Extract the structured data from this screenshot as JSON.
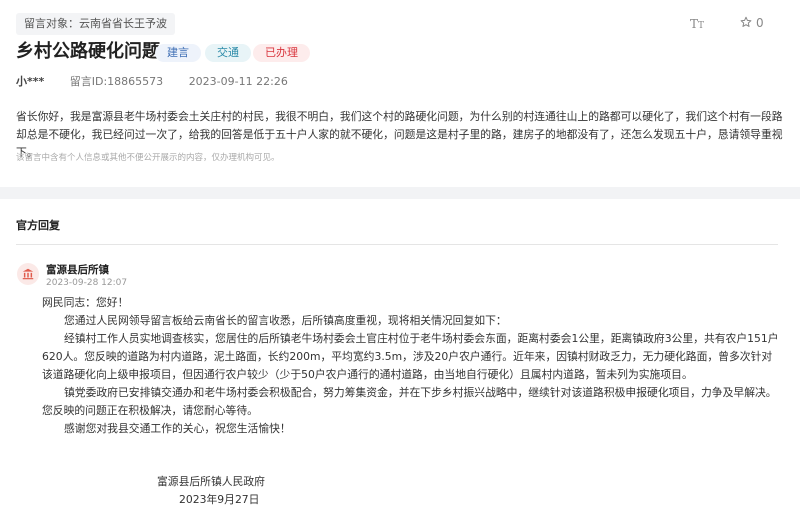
{
  "header": {
    "target_label": "留言对象：",
    "target_value": "云南省省长王予波",
    "font_size_label_big": "T",
    "font_size_label_small": "T",
    "favorite_count": "0"
  },
  "post": {
    "title": "乡村公路硬化问题",
    "tags": {
      "type": "建言",
      "department": "交通",
      "status": "已办理"
    },
    "user": "小***",
    "message_id": "留言ID:18865573",
    "time": "2023-09-11 22:26",
    "content": "省长你好，我是富源县老牛场村委会土关庄村的村民，我很不明白，我们这个村的路硬化问题，为什么别的村连通往山上的路都可以硬化了，我们这个村有一段路却总是不硬化，我已经问过一次了，给我的回答是低于五十户人家的就不硬化，问题是这是村子里的路，建房子的地都没有了，还怎么发现五十户，恳请领导重视下。",
    "privacy_note": "该留言中含有个人信息或其他不便公开展示的内容，仅办理机构可见。"
  },
  "official": {
    "section_title": "官方回复",
    "org_name": "富源县后所镇",
    "reply_time": "2023-09-28 12:07",
    "greeting": "网民同志：您好！",
    "paragraphs": [
      "您通过人民网领导留言板给云南省长的留言收悉，后所镇高度重视，现将相关情况回复如下：",
      "经镇村工作人员实地调查核实，您居住的后所镇老牛场村委会土官庄村位于老牛场村委会东面，距离村委会1公里，距离镇政府3公里，共有农户151户620人。您反映的道路为村内道路，泥土路面，长约200m，平均宽约3.5m，涉及20户农户通行。近年来，因镇村财政乏力，无力硬化路面，曾多次针对该道路硬化向上级申报项目，但因通行农户较少（少于50户农户通行的通村道路，由当地自行硬化）且属村内道路，暂未列为实施项目。",
      "镇党委政府已安排镇交通办和老牛场村委会积极配合，努力筹集资金，并在下步乡村振兴战略中，继续针对该道路积极申报硬化项目，力争及早解决。您反映的问题正在积极解决，请您耐心等待。",
      "感谢您对我县交通工作的关心，祝您生活愉快！"
    ],
    "signature": "富源县后所镇人民政府",
    "signature_date": "2023年9月27日"
  },
  "colors": {
    "status_red": "#d9363e",
    "tag_blue": "#3f6fb5",
    "tag_teal": "#2b8aa8",
    "org_icon_red": "#e05a4b"
  },
  "icons": [
    "font-size-icon",
    "star-icon",
    "government-building-icon"
  ]
}
